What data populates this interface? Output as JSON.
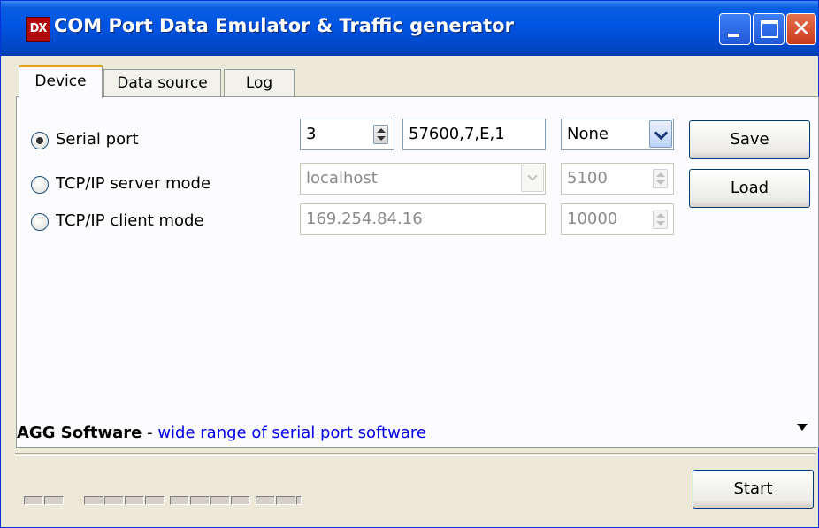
{
  "window": {
    "title": "COM Port Data Emulator & Traffic generator",
    "icon": "app-icon",
    "icon_text": "DX"
  },
  "tabs": [
    {
      "label": "Device",
      "active": true
    },
    {
      "label": "Data source",
      "active": false
    },
    {
      "label": "Log",
      "active": false
    }
  ],
  "device": {
    "modes": [
      {
        "label": "Serial port",
        "selected": true
      },
      {
        "label": "TCP/IP server mode",
        "selected": false
      },
      {
        "label": "TCP/IP client mode",
        "selected": false
      }
    ],
    "serial": {
      "port": "3",
      "settings": "57600,7,E,1",
      "flow_control": "None"
    },
    "server": {
      "host": "localhost",
      "port": "5100"
    },
    "client": {
      "host": "169.254.84.16",
      "port": "10000"
    },
    "save_label": "Save",
    "load_label": "Load"
  },
  "ad": {
    "brand": "AGG Software",
    "dash": " - ",
    "link_text": "wide range of serial port software"
  },
  "status": {
    "start_label": "Start",
    "led_groups": [
      2,
      4,
      4,
      3
    ]
  },
  "colors": {
    "titlebar": "#0054e3",
    "link": "#0000ee",
    "tab_highlight": "#e6a117"
  }
}
